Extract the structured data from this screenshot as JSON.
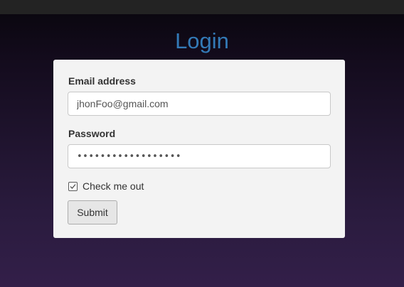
{
  "page": {
    "title": "Login"
  },
  "form": {
    "email_label": "Email address",
    "email_value": "jhonFoo@gmail.com",
    "password_label": "Password",
    "password_value": "••••••••••••••••••",
    "remember_label": "Check me out",
    "remember_checked": true,
    "submit_label": "Submit"
  },
  "colors": {
    "title": "#337ab7",
    "card_background": "#f3f3f3",
    "top_bar": "#232323"
  },
  "icons": {
    "checkbox": "check-icon"
  }
}
